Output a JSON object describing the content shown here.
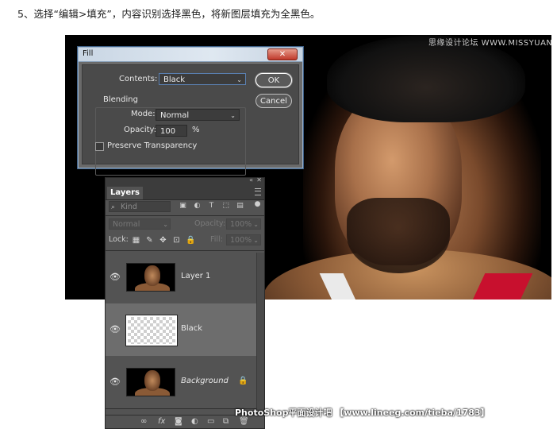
{
  "caption": "5、选择“编辑>填充”，内容识别选择黑色，将新图层填充为全黑色。",
  "photo": {
    "watermark": "思缘设计论坛 WWW.MISSYUAN.COM"
  },
  "fill_dialog": {
    "title": "Fill",
    "contents_label": "Contents:",
    "contents_value": "Black",
    "blending_label": "Blending",
    "mode_label": "Mode:",
    "mode_value": "Normal",
    "opacity_label": "Opacity:",
    "opacity_value": "100",
    "opacity_unit": "%",
    "preserve_label": "Preserve Transparency",
    "ok_label": "OK",
    "cancel_label": "Cancel"
  },
  "layers_panel": {
    "tab_label": "Layers",
    "kind_placeholder": "Kind",
    "blend_mode": "Normal",
    "opacity_label": "Opacity:",
    "opacity_value": "100%",
    "lock_label": "Lock:",
    "fill_label": "Fill:",
    "fill_value": "100%",
    "layers": [
      {
        "name": "Layer 1"
      },
      {
        "name": "Black"
      },
      {
        "name": "Background"
      }
    ]
  },
  "footer_watermark": "PhotoShop平面设计吧 【www.lineeg.com/tieba/1783】",
  "colors": {
    "dialog_border": "#3d5f86",
    "selected_layer": "#6d6d6d",
    "panel_bg": "#535353"
  }
}
